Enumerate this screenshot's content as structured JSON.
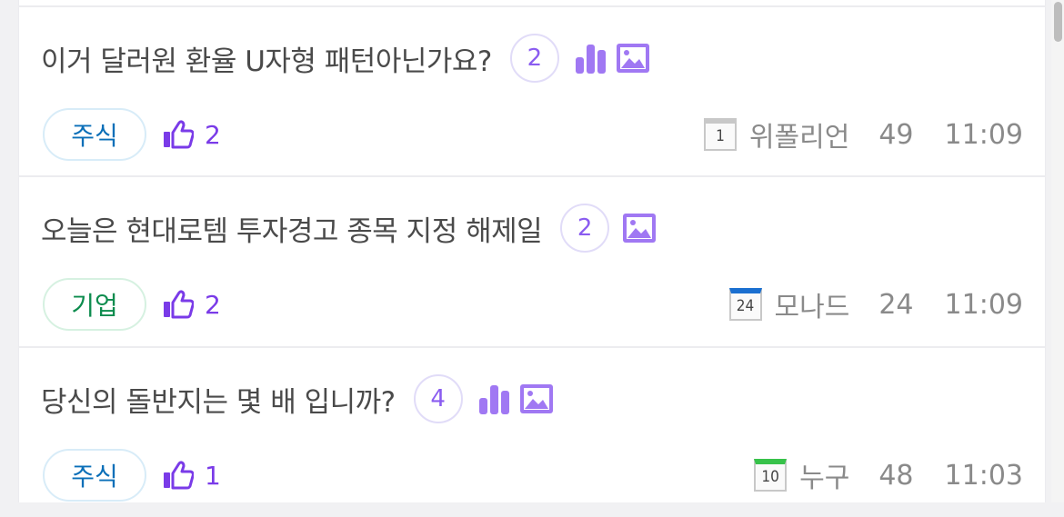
{
  "posts": [
    {
      "title": "이거 달러원 환율 U자형 패턴아닌가요?",
      "comments": "2",
      "has_chart": true,
      "has_image": true,
      "tag": "주식",
      "tag_kind": "stock",
      "likes": "2",
      "level": "1",
      "level_color": "#c8c8c8",
      "author": "위폴리언",
      "views": "49",
      "time": "11:09"
    },
    {
      "title": "오늘은 현대로템 투자경고 종목 지정 해제일",
      "comments": "2",
      "has_chart": false,
      "has_image": true,
      "tag": "기업",
      "tag_kind": "company",
      "likes": "2",
      "level": "24",
      "level_color": "#1a6fd0",
      "author": "모나드",
      "views": "24",
      "time": "11:09"
    },
    {
      "title": "당신의 돌반지는 몇 배 입니까?",
      "comments": "4",
      "has_chart": true,
      "has_image": true,
      "tag": "주식",
      "tag_kind": "stock",
      "likes": "1",
      "level": "10",
      "level_color": "#37c24a",
      "author": "누구",
      "views": "48",
      "time": "11:03"
    }
  ],
  "icons": {
    "chart": "bar-chart-icon",
    "image": "image-icon",
    "like": "thumbs-up-icon",
    "level": "level-calendar-icon"
  },
  "colors": {
    "accent": "#8a5cf0",
    "like": "#7a3be8",
    "tag_stock": "#0a6fb8",
    "tag_company": "#0d8c4e",
    "meta": "#8a8a8a"
  }
}
